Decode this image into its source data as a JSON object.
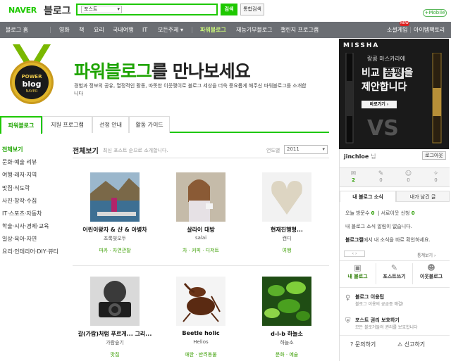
{
  "header": {
    "naver_label": "NAVER",
    "blog_label": "블로그",
    "search_select": "포스트",
    "search_button": "검색",
    "total_search_button": "통합검색",
    "mobile_button": "+Mobile"
  },
  "nav": {
    "items": [
      "블로그 홈",
      "영화",
      "책",
      "요리",
      "국내여행",
      "IT",
      "모든주제",
      "파워블로그",
      "재능기부블로그",
      "챌린지 프로그램"
    ],
    "right_items": [
      "소셜게임",
      "아이템팩토리"
    ],
    "new_badge": "NEW"
  },
  "hero": {
    "medal_line1": "POWER",
    "medal_line2": "blog",
    "medal_line3": "NAVER",
    "title_green": "파워블로그",
    "title_rest": "를 만나보세요",
    "desc": "경험과 정보의 공유, 열정적인 활동, 따뜻한 이웃맺이로 블로그 세상을 더욱 풍요롭게 해주신 파워블로그를 소개합니다"
  },
  "tabs": [
    "파워블로그",
    "지원 프로그램",
    "선정 안내",
    "활동 가이드"
  ],
  "sidebar": [
    "전체보기",
    "문화·예술 리뷰",
    "여행·레저·지역",
    "맛집·식도락",
    "사진·창작·수집",
    "IT·스포츠·자동차",
    "학술·시사·경제·교육",
    "일상·육아·자연",
    "요리·인테리어·DIY·뷰티"
  ],
  "section": {
    "title": "전체보기",
    "subtitle": "최신 포스트 순으로 소개합니다.",
    "year_label": "연도별",
    "year_value": "2011"
  },
  "cards": [
    {
      "title": "어린이왕자 & 샨 & 아병차",
      "author": "초록빛오두",
      "category": "파카 · 자연관찰"
    },
    {
      "title": "살라이 대방",
      "author": "salai",
      "category": "차 · 커피 · 디저트"
    },
    {
      "title": "현재진행형...",
      "author": "캔디",
      "category": "여행"
    },
    {
      "title": "갈(가람)처럼 푸르게... 그리...",
      "author": "가람숲기",
      "category": "맛집"
    },
    {
      "title": "Beetle holic",
      "author": "Helios",
      "category": "애완 · 반려동물"
    },
    {
      "title": "d-l-b 하늘소",
      "author": "하늘소",
      "category": "문화 · 예술"
    }
  ],
  "ad": {
    "brand": "MISSHA",
    "line1": "랑콤 마스카라에",
    "line2a": "비교",
    "line2b": "품평",
    "line2c": "을",
    "line3": "제안합니다",
    "button": "바로가기",
    "vs": "VS"
  },
  "panel": {
    "username": "jinchloe",
    "username_suffix": "님",
    "logout": "로그아웃",
    "stats": [
      "2",
      "0",
      "0",
      "0"
    ],
    "tab_news": "내 블로그 소식",
    "tab_mine": "내가 남긴 글",
    "visitors_label": "오늘 방문수",
    "visitors_value": "0",
    "neighbors_label": "서로이웃 신청",
    "neighbors_value": "0",
    "no_news": "내 블로그 소식 알림이 없습니다.",
    "promo_bold": "블로그캘",
    "promo_rest": "에서 내 소식을 바로 확인하세요.",
    "pager": "통계보기",
    "quick": [
      "내 블로그",
      "포스트쓰기",
      "이웃블로그"
    ],
    "item1_title": "블로그 이용팁",
    "item1_sub": "블로그 이용의 궁금증 해결!",
    "item2_title": "포스트 권리 보호하기",
    "item2_sub": "모든 블로거들의 권리를 보호합니다",
    "help": "문의하기",
    "report": "신고하기"
  }
}
